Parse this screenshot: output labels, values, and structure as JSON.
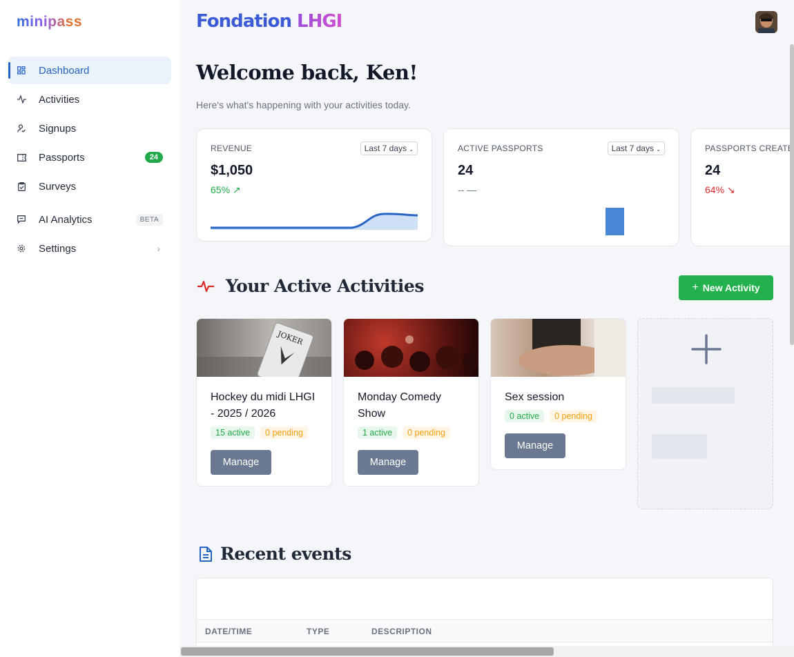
{
  "brand": {
    "logo_text": "minipass"
  },
  "org": {
    "name_part1": "Fondation",
    "name_part2": "LHGI"
  },
  "sidebar": {
    "items": [
      {
        "label": "Dashboard",
        "icon": "dashboard-icon",
        "active": true
      },
      {
        "label": "Activities",
        "icon": "activity-pulse-icon"
      },
      {
        "label": "Signups",
        "icon": "user-check-icon"
      },
      {
        "label": "Passports",
        "icon": "ticket-icon",
        "badge": "24"
      },
      {
        "label": "Surveys",
        "icon": "clipboard-check-icon"
      },
      {
        "label": "AI Analytics",
        "icon": "message-square-icon",
        "tag": "BETA"
      },
      {
        "label": "Settings",
        "icon": "gear-icon",
        "chevron": "›"
      }
    ]
  },
  "header": {
    "welcome": "Welcome back, Ken!",
    "subtitle": "Here's what's happening with your activities today."
  },
  "kpis": [
    {
      "label": "REVENUE",
      "period": "Last 7 days",
      "value": "$1,050",
      "change": "65%",
      "trend": "up"
    },
    {
      "label": "ACTIVE PASSPORTS",
      "period": "Last 7 days",
      "value": "24",
      "change": "-- —",
      "trend": "none"
    },
    {
      "label": "PASSPORTS CREATED",
      "value": "24",
      "change": "64%",
      "trend": "down"
    }
  ],
  "activities_section": {
    "title": "Your Active Activities",
    "new_button": "New Activity",
    "new_button_icon": "+"
  },
  "activities": [
    {
      "title": "Hockey du midi LHGI - 2025 / 2026",
      "active": "15 active",
      "pending": "0 pending",
      "manage": "Manage"
    },
    {
      "title": "Monday Comedy Show",
      "active": "1 active",
      "pending": "0 pending",
      "manage": "Manage"
    },
    {
      "title": "Sex session",
      "active": "0 active",
      "pending": "0 pending",
      "manage": "Manage"
    }
  ],
  "events_section": {
    "title": "Recent events",
    "columns": [
      "DATE/TIME",
      "TYPE",
      "DESCRIPTION"
    ]
  },
  "colors": {
    "primary": "#2563c4",
    "success": "#22b14c",
    "danger": "#dc2626",
    "manage_button": "#6b7891"
  }
}
